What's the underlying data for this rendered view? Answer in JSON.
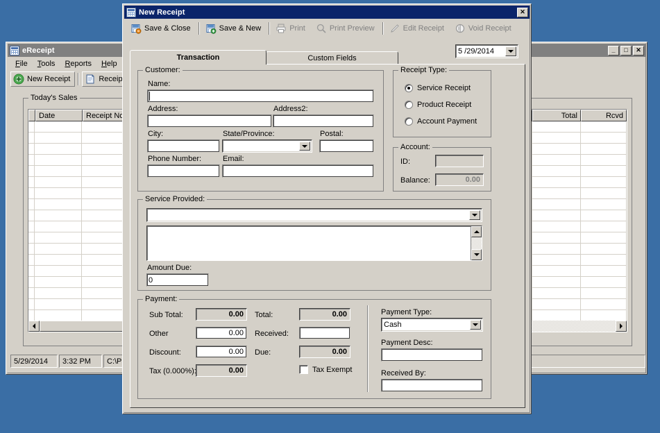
{
  "desktop": {
    "background_color": "#3a6ea5"
  },
  "background_window": {
    "title": "eReceipt",
    "icon": "grid-icon",
    "titlebar_color": "#808080",
    "controls": {
      "minimize": "_",
      "maximize": "□",
      "close": "✕"
    },
    "menu": [
      {
        "label": "File",
        "accel": "F"
      },
      {
        "label": "Tools",
        "accel": "T"
      },
      {
        "label": "Reports",
        "accel": "R"
      },
      {
        "label": "Help",
        "accel": "H"
      }
    ],
    "toolbar": [
      {
        "label": "New Receipt",
        "icon": "green-plus-circle-icon",
        "enabled": true
      },
      {
        "label": "Receipt ...",
        "icon": "document-icon",
        "enabled": true
      }
    ],
    "grid_group_title": "Today's Sales",
    "grid": {
      "columns": [
        "Date",
        "Receipt No.",
        "Total",
        "Rcvd"
      ],
      "rows": []
    },
    "statusbar": [
      {
        "text": "5/29/2014"
      },
      {
        "text": "3:32 PM"
      },
      {
        "text": "C:\\P"
      }
    ]
  },
  "dialog": {
    "title": "New Receipt",
    "icon": "grid-icon",
    "titlebar_color": "#0a246a",
    "close_label": "✕",
    "toolbar": [
      {
        "label": "Save & Close",
        "icon": "save-close-icon",
        "enabled": true
      },
      {
        "label": "Save & New",
        "icon": "save-new-icon",
        "enabled": true
      },
      {
        "label": "Print",
        "icon": "printer-icon",
        "enabled": false
      },
      {
        "label": "Print Preview",
        "icon": "magnifier-icon",
        "enabled": false
      },
      {
        "label": "Edit Receipt",
        "icon": "pencil-icon",
        "enabled": false
      },
      {
        "label": "Void Receipt",
        "icon": "void-icon",
        "enabled": false
      }
    ],
    "date_picker": {
      "value": "5 /29/2014",
      "dropdown_icon": "chevron-down-icon"
    },
    "tabs": [
      {
        "label": "Transaction",
        "active": true
      },
      {
        "label": "Custom Fields",
        "active": false
      }
    ],
    "customer": {
      "group_title": "Customer:",
      "name": {
        "label": "Name:",
        "value": ""
      },
      "address": {
        "label": "Address:",
        "value": ""
      },
      "address2": {
        "label": "Address2:",
        "value": ""
      },
      "city": {
        "label": "City:",
        "value": ""
      },
      "state": {
        "label": "State/Province:",
        "value": ""
      },
      "postal": {
        "label": "Postal:",
        "value": ""
      },
      "phone": {
        "label": "Phone Number:",
        "value": ""
      },
      "email": {
        "label": "Email:",
        "value": ""
      }
    },
    "receipt_type": {
      "group_title": "Receipt Type:",
      "options": [
        {
          "label": "Service Receipt",
          "selected": true
        },
        {
          "label": "Product Receipt",
          "selected": false
        },
        {
          "label": "Account Payment",
          "selected": false
        }
      ]
    },
    "account": {
      "group_title": "Account:",
      "id": {
        "label": "ID:",
        "value": ""
      },
      "balance": {
        "label": "Balance:",
        "value": "0.00"
      }
    },
    "service_provided": {
      "group_title": "Service Provided:",
      "service_select_value": "",
      "description_value": "",
      "amount_due": {
        "label": "Amount Due:",
        "value": "0"
      }
    },
    "payment": {
      "group_title": "Payment:",
      "sub_total": {
        "label": "Sub Total:",
        "value": "0.00"
      },
      "other": {
        "label": "Other",
        "value": "0.00"
      },
      "discount": {
        "label": "Discount:",
        "value": "0.00"
      },
      "tax": {
        "label": "Tax (0.000%):",
        "value": "0.00"
      },
      "total": {
        "label": "Total:",
        "value": "0.00"
      },
      "received": {
        "label": "Received:",
        "value": ""
      },
      "due": {
        "label": "Due:",
        "value": "0.00"
      },
      "tax_exempt": {
        "label": "Tax Exempt",
        "checked": false
      },
      "payment_type": {
        "label": "Payment Type:",
        "value": "Cash"
      },
      "payment_desc": {
        "label": "Payment Desc:",
        "value": ""
      },
      "received_by": {
        "label": "Received By:",
        "value": ""
      }
    }
  }
}
